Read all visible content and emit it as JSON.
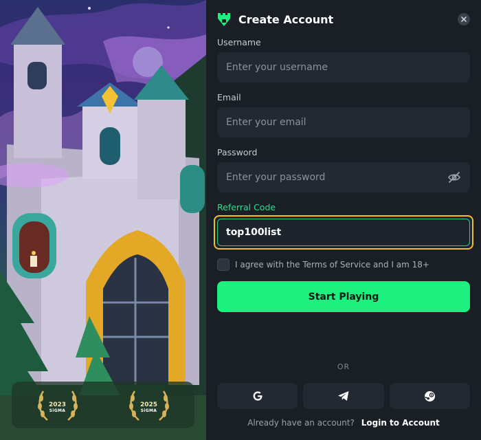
{
  "header": {
    "title": "Create Account",
    "logo_icon": "castle-logo-icon",
    "close_icon": "close-icon"
  },
  "form": {
    "username": {
      "label": "Username",
      "placeholder": "Enter your username",
      "value": ""
    },
    "email": {
      "label": "Email",
      "placeholder": "Enter your email",
      "value": ""
    },
    "password": {
      "label": "Password",
      "placeholder": "Enter your password",
      "value": "",
      "toggle_icon": "eye-off-icon"
    },
    "referral": {
      "label": "Referral Code",
      "placeholder": "",
      "value": "top100list"
    },
    "agree_text": "I agree with the Terms of Service and I am 18+",
    "agree_checked": false,
    "submit_label": "Start Playing"
  },
  "divider_text": "OR",
  "social_logins": [
    {
      "name": "google",
      "icon": "google-icon"
    },
    {
      "name": "telegram",
      "icon": "telegram-icon"
    },
    {
      "name": "steam",
      "icon": "steam-icon"
    }
  ],
  "footer": {
    "prompt": "Already have an account?",
    "login_link": "Login to Account"
  },
  "awards": [
    {
      "year": "2023",
      "org": "SiGMA"
    },
    {
      "year": "2025",
      "org": "SiGMA"
    }
  ],
  "colors": {
    "accent": "#1ef07f",
    "background": "#1a1f26",
    "field_bg": "#232932",
    "highlight": "#f2c02a",
    "label_active": "#23e28a"
  }
}
